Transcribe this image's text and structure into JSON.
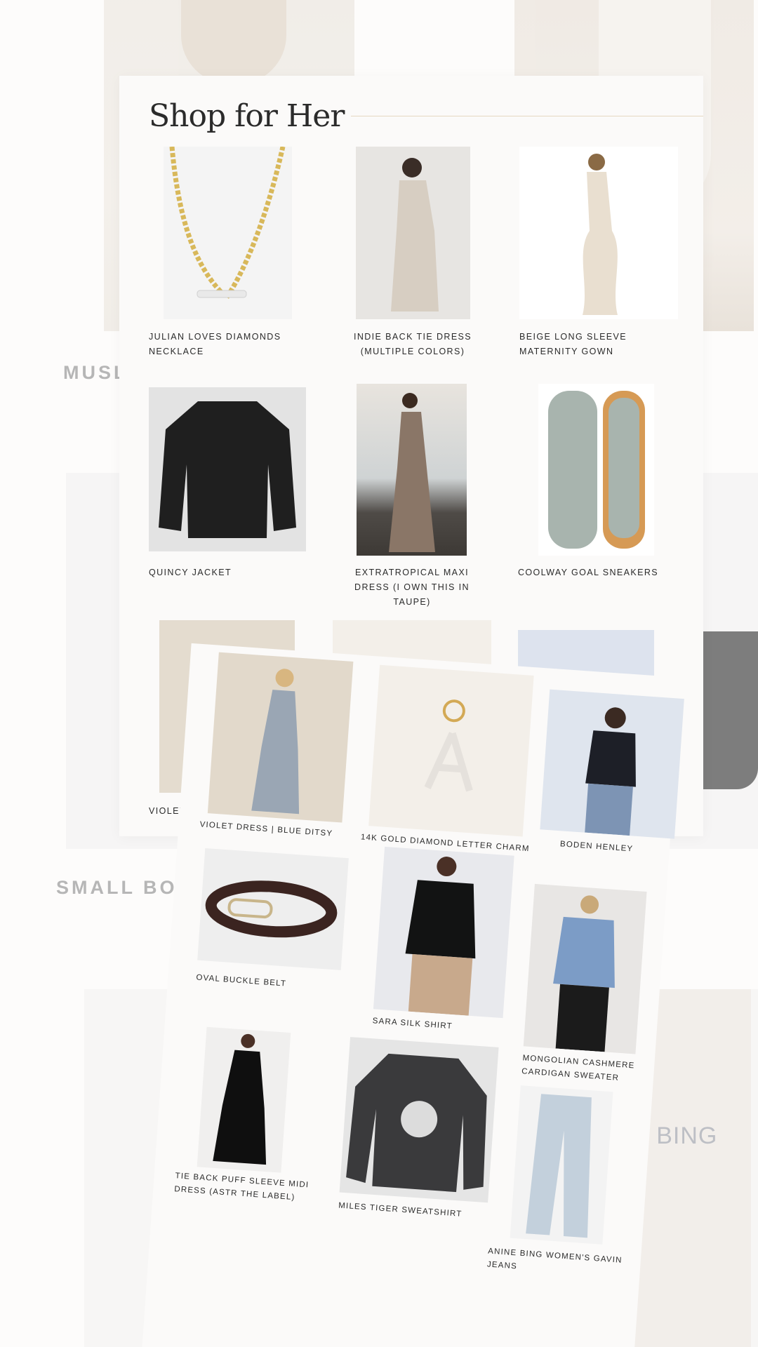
{
  "background": {
    "heading_1": "MUSL",
    "heading_2": "SMALL BOLD",
    "tee_print": "NNE BING"
  },
  "card": {
    "title": "Shop for Her",
    "accent_color": "#e5d7c0",
    "products": [
      {
        "label": "JULIAN LOVES DIAMONDS NECKLACE",
        "icon": "necklace-image"
      },
      {
        "label": "INDIE BACK TIE DRESS (MULTIPLE COLORS)",
        "icon": "dress-image"
      },
      {
        "label": "BEIGE LONG SLEEVE MATERNITY GOWN",
        "icon": "gown-image"
      },
      {
        "label": "QUINCY JACKET",
        "icon": "jacket-image"
      },
      {
        "label": "EXTRATROPICAL MAXI DRESS (I OWN THIS IN TAUPE)",
        "icon": "maxi-dress-image"
      },
      {
        "label": "COOLWAY GOAL SNEAKERS",
        "icon": "sneakers-image"
      },
      {
        "label": "VIOLET DR",
        "icon": "violet-dress-image"
      }
    ]
  },
  "overlay": {
    "products": [
      {
        "label": "VIOLET DRESS | BLUE DITSY"
      },
      {
        "label": "14K GOLD DIAMOND LETTER CHARM"
      },
      {
        "label": "BODEN HENLEY"
      },
      {
        "label": "OVAL BUCKLE BELT"
      },
      {
        "label": "SARA SILK SHIRT"
      },
      {
        "label": "MONGOLIAN CASHMERE",
        "label2": "CARDIGAN SWEATER"
      },
      {
        "label": "TIE BACK PUFF SLEEVE MIDI",
        "label2": "DRESS (ASTR THE LABEL)"
      },
      {
        "label": "MILES TIGER SWEATSHIRT"
      },
      {
        "label": "ANINE BING WOMEN'S GAVIN",
        "label2": "JEANS"
      }
    ]
  }
}
